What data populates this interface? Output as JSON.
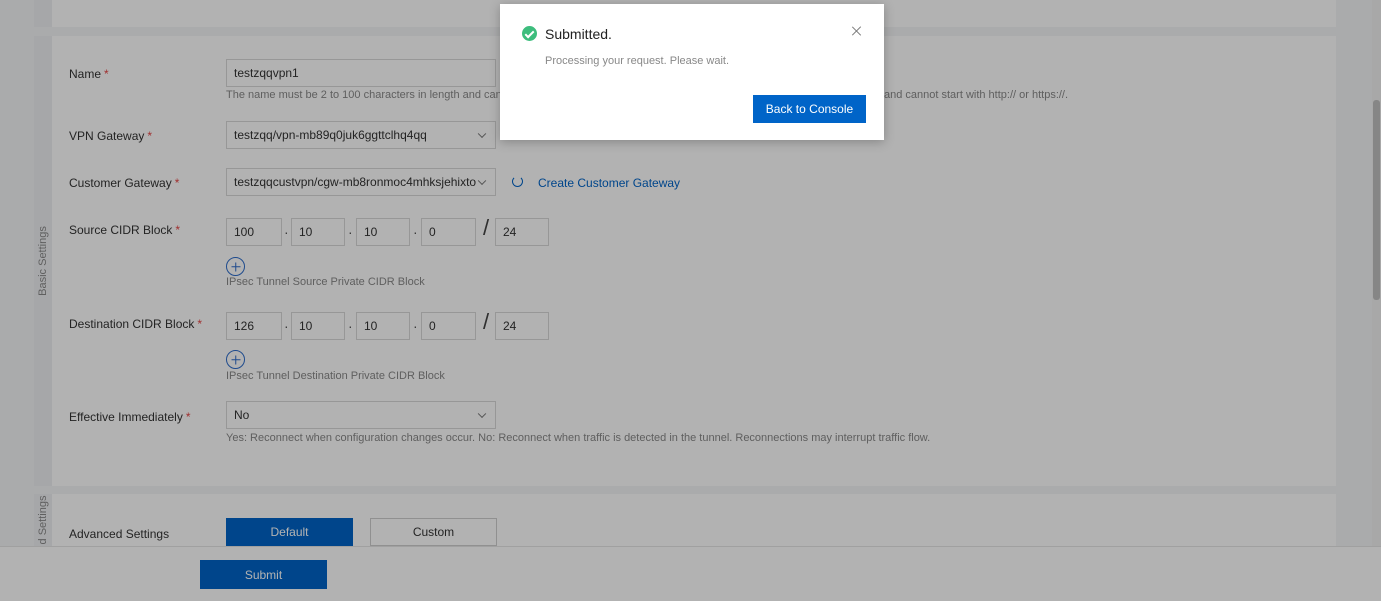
{
  "basic_settings": {
    "section_label": "Basic Settings",
    "name": {
      "label": "Name",
      "value": "testzqqvpn1",
      "help": "The name must be 2 to 100 characters in length and can c",
      "help_tail": "and cannot start with http:// or https://."
    },
    "vpn_gateway": {
      "label": "VPN Gateway",
      "value": "testzqq/vpn-mb89q0juk6ggttclhq4qq"
    },
    "customer_gateway": {
      "label": "Customer Gateway",
      "value": "testzqqcustvpn/cgw-mb8ronmoc4mhksjehixto",
      "refresh_icon": "refresh-icon",
      "create_link": "Create Customer Gateway"
    },
    "source_cidr": {
      "label": "Source CIDR Block",
      "octets": [
        "100",
        "10",
        "10",
        "0"
      ],
      "mask": "24",
      "help": "IPsec Tunnel Source Private CIDR Block"
    },
    "destination_cidr": {
      "label": "Destination CIDR Block",
      "octets": [
        "126",
        "10",
        "10",
        "0"
      ],
      "mask": "24",
      "help": "IPsec Tunnel Destination Private CIDR Block"
    },
    "effective_immediately": {
      "label": "Effective Immediately",
      "value": "No",
      "help": "Yes: Reconnect when configuration changes occur. No: Reconnect when traffic is detected in the tunnel. Reconnections may interrupt traffic flow."
    },
    "required_mark": "*",
    "octet_separator": "·",
    "mask_separator": "/"
  },
  "advanced_settings": {
    "section_label": "d Settings",
    "label": "Advanced Settings",
    "options": [
      "Default",
      "Custom"
    ],
    "selected": "Default"
  },
  "footer": {
    "submit_label": "Submit"
  },
  "dialog": {
    "title": "Submitted.",
    "message": "Processing your request. Please wait.",
    "button_label": "Back to Console",
    "icon": "success-check-icon"
  },
  "colors": {
    "primary": "#0064c8",
    "success": "#3dbd7d",
    "required": "#e64646"
  }
}
